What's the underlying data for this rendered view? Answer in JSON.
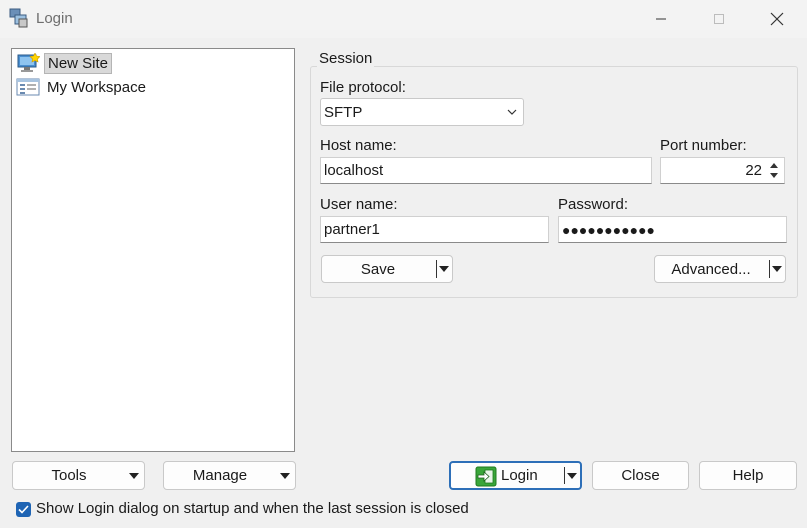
{
  "window": {
    "title": "Login"
  },
  "colors": {
    "accent": "#1e64b4",
    "login_icon": "#3aa63a",
    "background": "#f0f0f0"
  },
  "tree": {
    "items": [
      {
        "label": "New Site",
        "icon": "monitor-star-icon",
        "selected": true
      },
      {
        "label": "My Workspace",
        "icon": "workspace-folder-icon",
        "selected": false
      }
    ]
  },
  "session": {
    "legend": "Session",
    "protocol_label": "File protocol:",
    "protocol_value": "SFTP",
    "host_label": "Host name:",
    "host_value": "localhost",
    "port_label": "Port number:",
    "port_value": "22",
    "user_label": "User name:",
    "user_value": "partner1",
    "password_label": "Password:",
    "password_value": "●●●●●●●●●●●",
    "save_label": "Save",
    "advanced_label": "Advanced..."
  },
  "footer": {
    "tools_label": "Tools",
    "manage_label": "Manage",
    "login_label": "Login",
    "close_label": "Close",
    "help_label": "Help",
    "startup_checkbox_label": "Show Login dialog on startup and when the last session is closed",
    "startup_checked": true
  }
}
